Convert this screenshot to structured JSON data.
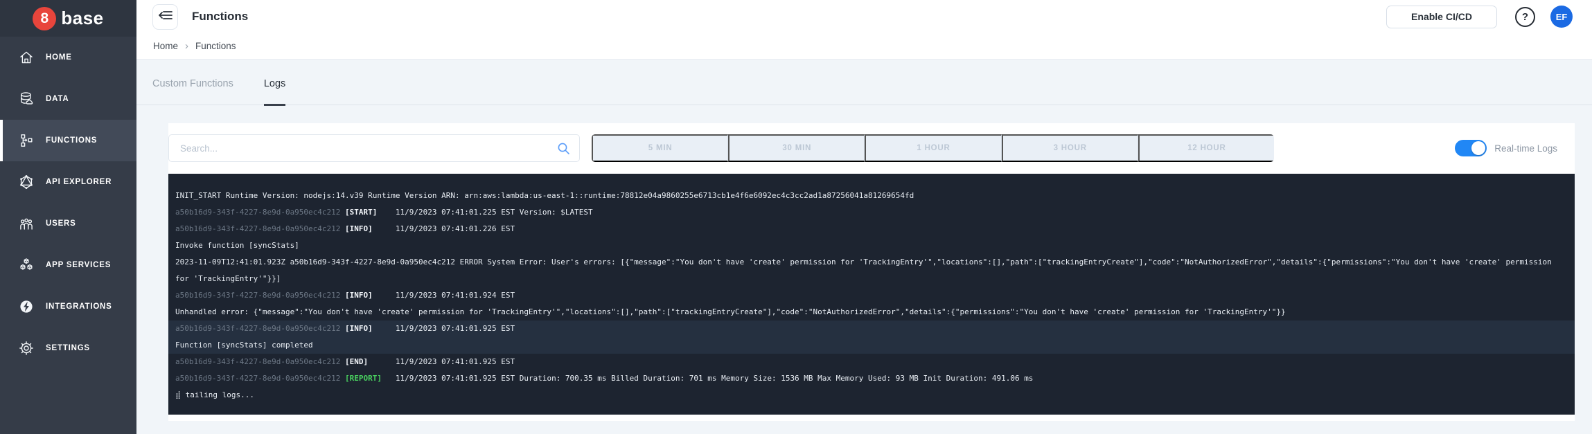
{
  "brand": {
    "logo_number": "8",
    "logo_text": "base"
  },
  "sidebar": {
    "items": [
      {
        "label": "HOME",
        "icon": "home-icon"
      },
      {
        "label": "DATA",
        "icon": "database-icon"
      },
      {
        "label": "FUNCTIONS",
        "icon": "functions-icon",
        "active": true
      },
      {
        "label": "API EXPLORER",
        "icon": "api-explorer-icon"
      },
      {
        "label": "USERS",
        "icon": "users-icon"
      },
      {
        "label": "APP SERVICES",
        "icon": "app-services-icon"
      },
      {
        "label": "INTEGRATIONS",
        "icon": "integrations-icon"
      },
      {
        "label": "SETTINGS",
        "icon": "settings-icon"
      }
    ]
  },
  "header": {
    "title": "Functions",
    "enable_cicd_label": "Enable CI/CD",
    "help_label": "?",
    "avatar_initials": "EF"
  },
  "breadcrumb": {
    "home": "Home",
    "separator": "›",
    "current": "Functions"
  },
  "tabs": {
    "custom_functions": "Custom Functions",
    "logs": "Logs"
  },
  "toolbar": {
    "search_placeholder": "Search...",
    "search_value": "",
    "time_ranges": [
      "5 MIN",
      "30 MIN",
      "1 HOUR",
      "3 HOUR",
      "12 HOUR"
    ],
    "realtime_label": "Real-time Logs",
    "realtime_on": true
  },
  "colors": {
    "brand_red": "#e8453c",
    "accent_blue": "#2187f5",
    "avatar_blue": "#1b6ae3",
    "sidebar_bg": "#353c48",
    "console_bg": "#1d2430",
    "console_highlight_bg": "#253040",
    "log_green": "#49d05f"
  },
  "console": {
    "lines": [
      {
        "highlight": false,
        "segments": [
          {
            "style": "default",
            "text": "INIT_START Runtime Version: nodejs:14.v39 Runtime Version ARN: arn:aws:lambda:us-east-1::runtime:78812e04a9860255e6713cb1e4f6e6092ec4c3cc2ad1a87256041a81269654fd"
          }
        ]
      },
      {
        "highlight": false,
        "segments": [
          {
            "style": "muted",
            "text": "a50b16d9-343f-4227-8e9d-0a950ec4c212 "
          },
          {
            "style": "tag",
            "text": "[START]"
          },
          {
            "style": "default",
            "text": "    11/9/2023 07:41:01.225 EST Version: $LATEST"
          }
        ]
      },
      {
        "highlight": false,
        "segments": [
          {
            "style": "muted",
            "text": "a50b16d9-343f-4227-8e9d-0a950ec4c212 "
          },
          {
            "style": "tag",
            "text": "[INFO]"
          },
          {
            "style": "default",
            "text": "     11/9/2023 07:41:01.226 EST"
          }
        ]
      },
      {
        "highlight": false,
        "segments": [
          {
            "style": "default",
            "text": "Invoke function [syncStats]"
          }
        ]
      },
      {
        "highlight": false,
        "segments": [
          {
            "style": "default",
            "text": "2023-11-09T12:41:01.923Z a50b16d9-343f-4227-8e9d-0a950ec4c212 ERROR System Error: User's errors: [{\"message\":\"You don't have 'create' permission for 'TrackingEntry'\",\"locations\":[],\"path\":[\"trackingEntryCreate\"],\"code\":\"NotAuthorizedError\",\"details\":{\"permissions\":\"You don't have 'create' permission for 'TrackingEntry'\"}}]"
          }
        ]
      },
      {
        "highlight": false,
        "segments": [
          {
            "style": "muted",
            "text": "a50b16d9-343f-4227-8e9d-0a950ec4c212 "
          },
          {
            "style": "tag",
            "text": "[INFO]"
          },
          {
            "style": "default",
            "text": "     11/9/2023 07:41:01.924 EST"
          }
        ]
      },
      {
        "highlight": false,
        "segments": [
          {
            "style": "default",
            "text": "Unhandled error: {\"message\":\"You don't have 'create' permission for 'TrackingEntry'\",\"locations\":[],\"path\":[\"trackingEntryCreate\"],\"code\":\"NotAuthorizedError\",\"details\":{\"permissions\":\"You don't have 'create' permission for 'TrackingEntry'\"}}"
          }
        ]
      },
      {
        "highlight": true,
        "segments": [
          {
            "style": "muted",
            "text": "a50b16d9-343f-4227-8e9d-0a950ec4c212 "
          },
          {
            "style": "tag",
            "text": "[INFO]"
          },
          {
            "style": "default",
            "text": "     11/9/2023 07:41:01.925 EST"
          }
        ]
      },
      {
        "highlight": true,
        "segments": [
          {
            "style": "default",
            "text": "Function [syncStats] completed"
          }
        ]
      },
      {
        "highlight": false,
        "segments": [
          {
            "style": "muted",
            "text": "a50b16d9-343f-4227-8e9d-0a950ec4c212 "
          },
          {
            "style": "tag",
            "text": "[END]"
          },
          {
            "style": "default",
            "text": "      11/9/2023 07:41:01.925 EST"
          }
        ]
      },
      {
        "highlight": false,
        "segments": [
          {
            "style": "muted",
            "text": "a50b16d9-343f-4227-8e9d-0a950ec4c212 "
          },
          {
            "style": "tag-green",
            "text": "[REPORT]"
          },
          {
            "style": "default",
            "text": "   11/9/2023 07:41:01.925 EST Duration: 700.35 ms Billed Duration: 701 ms Memory Size: 1536 MB Max Memory Used: 93 MB Init Duration: 491.06 ms"
          }
        ]
      },
      {
        "highlight": false,
        "segments": [
          {
            "style": "default",
            "text": "⣾ tailing logs..."
          }
        ]
      }
    ]
  }
}
